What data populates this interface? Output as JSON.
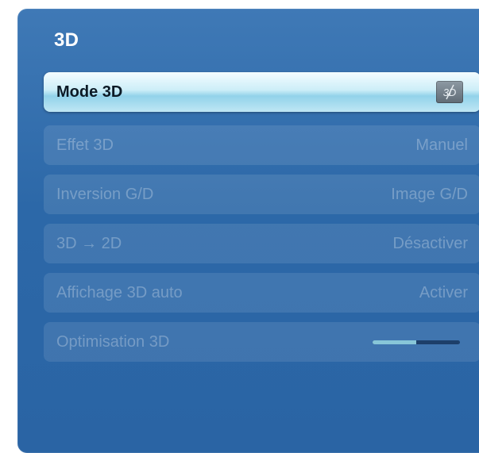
{
  "menu": {
    "title": "3D",
    "items": [
      {
        "label": "Mode 3D",
        "value": "",
        "icon": "3d-off-icon"
      },
      {
        "label": "Effet 3D",
        "value": "Manuel"
      },
      {
        "label": "Inversion G/D",
        "value": "Image G/D"
      },
      {
        "label": "3D → 2D",
        "value": "Désactiver"
      },
      {
        "label": "Affichage 3D auto",
        "value": "Activer"
      },
      {
        "label": "Optimisation 3D",
        "value": "",
        "slider_level": 0.5
      }
    ]
  },
  "colors": {
    "panel": "#2c68a8",
    "selected_highlight": "#92d2ea",
    "slider_fill": "#88c6d8",
    "slider_track": "#1d3f6a"
  }
}
